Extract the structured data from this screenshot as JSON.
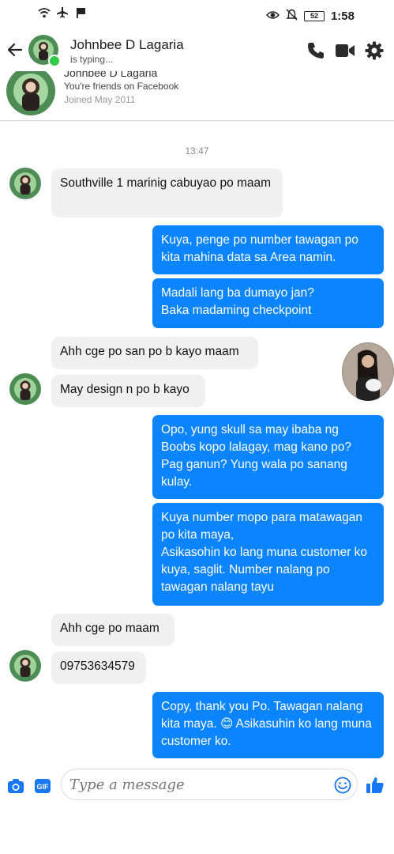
{
  "status_bar": {
    "time": "1:58",
    "battery": "52"
  },
  "header": {
    "name": "Johnbee D Lagaria",
    "status": "is typing..."
  },
  "profile": {
    "name": "Johnbee D Lagaria",
    "friends_line": "You're friends on Facebook",
    "joined_line": "Joined May 2011"
  },
  "chat": {
    "timestamp": "13:47",
    "messages": [
      {
        "text": "Southville 1 marinig cabuyao po maam"
      },
      {
        "text": "Kuya, penge po number tawagan po kita mahina data sa Area namin."
      },
      {
        "text": "Madali lang ba dumayo jan?\nBaka madaming checkpoint"
      },
      {
        "text": "Ahh cge po san po b kayo maam"
      },
      {
        "text": "May design n po b kayo"
      },
      {
        "text": "Opo, yung skull sa may ibaba ng Boobs kopo lalagay, mag kano po? Pag ganun? Yung wala po sanang kulay."
      },
      {
        "text": "Kuya number mopo para matawagan po kita maya,\nAsikasohin ko lang muna customer ko kuya, saglit. Number nalang po tawagan nalang tayu"
      },
      {
        "text": "Ahh cge po maam"
      },
      {
        "text": "09753634579"
      },
      {
        "text": "Copy, thank you Po. Tawagan nalang kita maya. 😊 Asikasuhin ko lang muna customer ko."
      }
    ]
  },
  "composer": {
    "placeholder": "Type a message"
  },
  "colors": {
    "accent": "#0b84ff",
    "incoming_bubble": "#f1f0f0",
    "online": "#31cc46"
  },
  "icons": [
    "wifi-icon",
    "airplane-icon",
    "flag-icon",
    "eye-icon",
    "mute-icon",
    "back-arrow-icon",
    "phone-icon",
    "video-call-icon",
    "settings-gear-icon",
    "camera-icon",
    "gif-icon",
    "emoji-icon",
    "thumbs-up-icon"
  ]
}
